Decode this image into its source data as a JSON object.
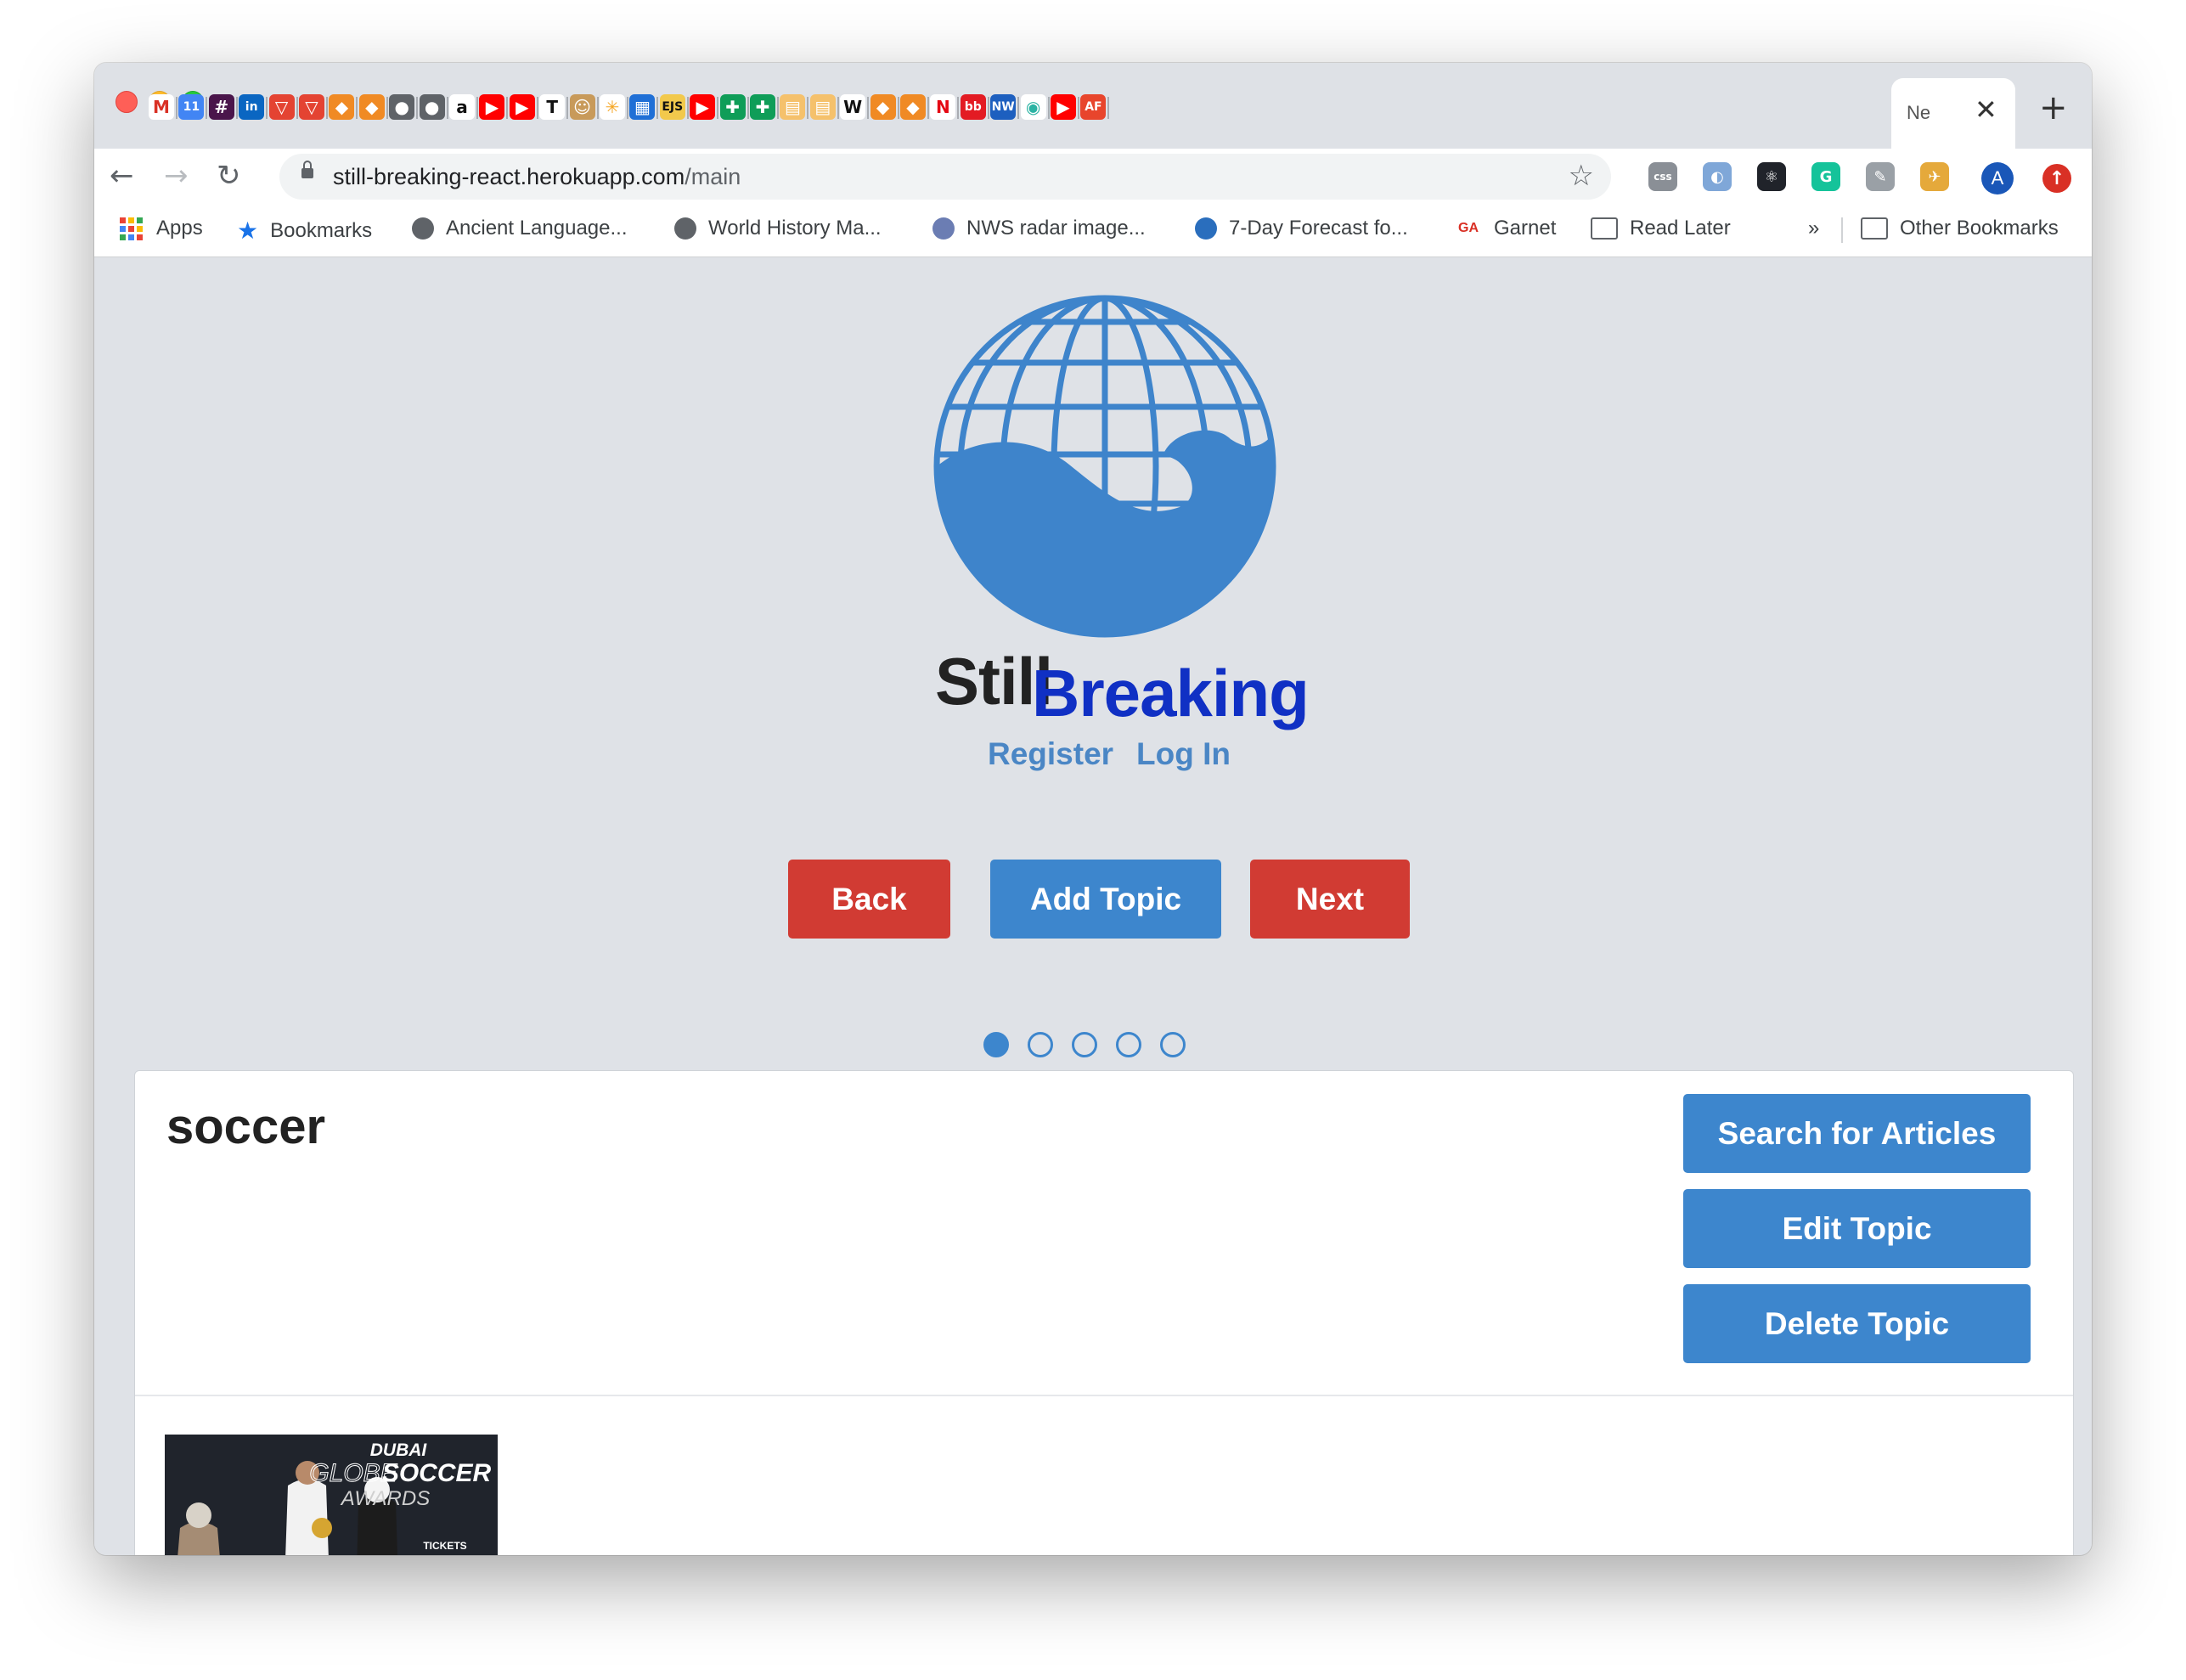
{
  "browser": {
    "active_tab_title": "Ne",
    "close_symbol": "✕",
    "new_tab_symbol": "+",
    "url_host": "still-breaking-react.herokuapp.com",
    "url_path": "/main",
    "tab_icons": [
      {
        "name": "gmail-icon",
        "glyph": "M",
        "bg": "#ffffff",
        "fg": "#d93025"
      },
      {
        "name": "calendar-icon",
        "glyph": "11",
        "bg": "#4285f4",
        "fg": "#ffffff"
      },
      {
        "name": "slack-icon",
        "glyph": "#",
        "bg": "#4a154b",
        "fg": "#ffffff"
      },
      {
        "name": "linkedin-icon",
        "glyph": "in",
        "bg": "#0a66c2",
        "fg": "#ffffff"
      },
      {
        "name": "todoist-icon",
        "glyph": "▽",
        "bg": "#e44332",
        "fg": "#ffffff"
      },
      {
        "name": "todoist-icon",
        "glyph": "▽",
        "bg": "#e44332",
        "fg": "#ffffff"
      },
      {
        "name": "package-icon",
        "glyph": "◆",
        "bg": "#f08a24",
        "fg": "#ffffff"
      },
      {
        "name": "package-icon",
        "glyph": "◆",
        "bg": "#f08a24",
        "fg": "#ffffff"
      },
      {
        "name": "globe-icon",
        "glyph": "●",
        "bg": "#5f6368",
        "fg": "#ffffff"
      },
      {
        "name": "globe-icon",
        "glyph": "●",
        "bg": "#5f6368",
        "fg": "#ffffff"
      },
      {
        "name": "amazon-icon",
        "glyph": "a",
        "bg": "#ffffff",
        "fg": "#111111"
      },
      {
        "name": "youtube-icon",
        "glyph": "▶",
        "bg": "#ff0000",
        "fg": "#ffffff"
      },
      {
        "name": "youtube-icon",
        "glyph": "▶",
        "bg": "#ff0000",
        "fg": "#ffffff"
      },
      {
        "name": "nytimes-icon",
        "glyph": "T",
        "bg": "#ffffff",
        "fg": "#111111"
      },
      {
        "name": "meerkat-icon",
        "glyph": "☺",
        "bg": "#c89a5a",
        "fg": "#ffffff"
      },
      {
        "name": "spark-icon",
        "glyph": "✳",
        "bg": "#ffffff",
        "fg": "#f5a623"
      },
      {
        "name": "dashboard-icon",
        "glyph": "▦",
        "bg": "#1f6fd6",
        "fg": "#ffffff"
      },
      {
        "name": "ejs-icon",
        "glyph": "EJS",
        "bg": "#f2c94c",
        "fg": "#111111"
      },
      {
        "name": "youtube-icon",
        "glyph": "▶",
        "bg": "#ff0000",
        "fg": "#ffffff"
      },
      {
        "name": "sheets-icon",
        "glyph": "✚",
        "bg": "#0f9d58",
        "fg": "#ffffff"
      },
      {
        "name": "sheets-icon",
        "glyph": "✚",
        "bg": "#0f9d58",
        "fg": "#ffffff"
      },
      {
        "name": "book-icon",
        "glyph": "▤",
        "bg": "#f5c16c",
        "fg": "#ffffff"
      },
      {
        "name": "book-icon",
        "glyph": "▤",
        "bg": "#f5c16c",
        "fg": "#ffffff"
      },
      {
        "name": "wikipedia-icon",
        "glyph": "W",
        "bg": "#ffffff",
        "fg": "#111111"
      },
      {
        "name": "package-icon",
        "glyph": "◆",
        "bg": "#f08a24",
        "fg": "#ffffff"
      },
      {
        "name": "package-icon",
        "glyph": "◆",
        "bg": "#f08a24",
        "fg": "#ffffff"
      },
      {
        "name": "netflix-icon",
        "glyph": "N",
        "bg": "#ffffff",
        "fg": "#e50914"
      },
      {
        "name": "bb-icon",
        "glyph": "bb",
        "bg": "#e31b23",
        "fg": "#ffffff"
      },
      {
        "name": "nw-icon",
        "glyph": "NW",
        "bg": "#1d5fbf",
        "fg": "#ffffff"
      },
      {
        "name": "eye-icon",
        "glyph": "◉",
        "bg": "#ffffff",
        "fg": "#2bb3a3"
      },
      {
        "name": "youtube-icon",
        "glyph": "▶",
        "bg": "#ff0000",
        "fg": "#ffffff"
      },
      {
        "name": "af-icon",
        "glyph": "AF",
        "bg": "#e8452c",
        "fg": "#ffffff"
      }
    ],
    "extension_icons": [
      {
        "name": "css-extension-icon",
        "glyph": "css",
        "bg": "#8a8f96"
      },
      {
        "name": "circle-extension-icon",
        "glyph": "◐",
        "bg": "#7fa7d8"
      },
      {
        "name": "react-devtools-icon",
        "glyph": "⚛",
        "bg": "#20232a"
      },
      {
        "name": "grammarly-icon",
        "glyph": "G",
        "bg": "#15c39a"
      },
      {
        "name": "eyedropper-icon",
        "glyph": "✎",
        "bg": "#9aa0a6"
      },
      {
        "name": "ufo-extension-icon",
        "glyph": "✈",
        "bg": "#e5a93b"
      }
    ],
    "profile_initial": "A",
    "update_symbol": "↑"
  },
  "bookmarks": {
    "apps": "Apps",
    "bookmarks": "Bookmarks",
    "ancient": "Ancient Language...",
    "world_history": "World History Ma...",
    "nws": "NWS radar image...",
    "forecast": "7-Day Forecast fo...",
    "garnet_prefix": "GA",
    "garnet": "Garnet",
    "read_later": "Read Later",
    "overflow": "»",
    "other": "Other Bookmarks"
  },
  "app": {
    "brand_still": "Still",
    "brand_breaking": "Breaking",
    "register": "Register",
    "login": "Log In",
    "back": "Back",
    "add_topic": "Add Topic",
    "next": "Next",
    "pager": {
      "count": 5,
      "active_index": 0
    },
    "topic": {
      "title": "soccer",
      "search": "Search for Articles",
      "edit": "Edit Topic",
      "delete": "Delete Topic",
      "article_image_text": {
        "line1": "DUBAI",
        "line2a": "GLOBE",
        "line2b": "SOCCER",
        "line3": "AWARDS",
        "sponsor": "TICKETS"
      }
    },
    "colors": {
      "brand_blue": "#1030c4",
      "primary_blue": "#3d86cd",
      "danger_red": "#d13b33",
      "link_blue": "#4a86c5"
    }
  }
}
